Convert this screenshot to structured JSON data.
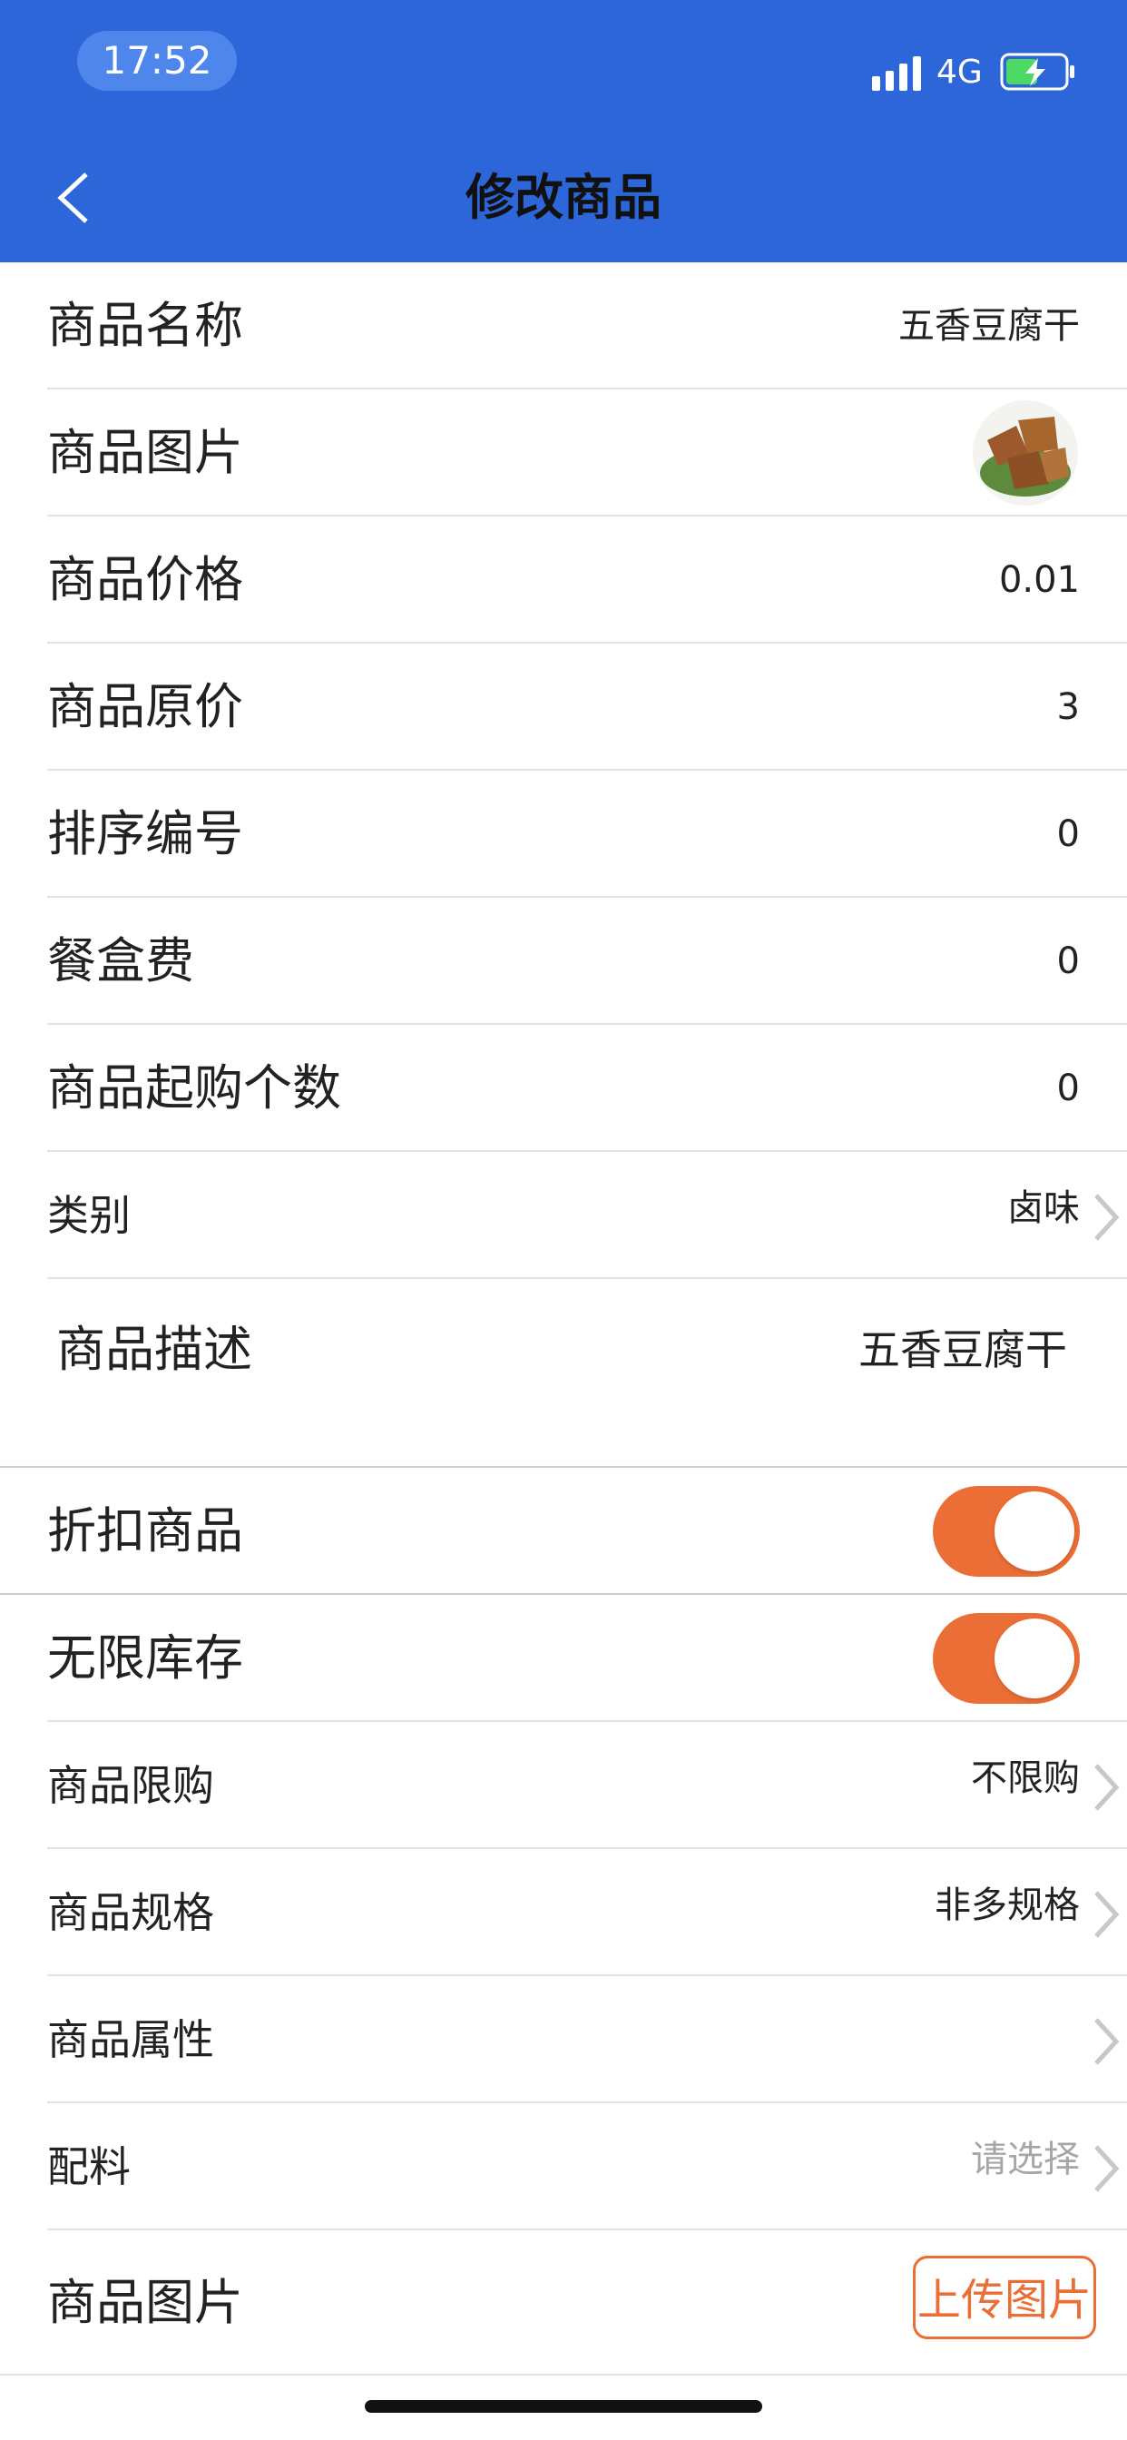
{
  "status_bar": {
    "time": "17:52",
    "network": "4G"
  },
  "header": {
    "title": "修改商品"
  },
  "rows": {
    "name": {
      "label": "商品名称",
      "value": "五香豆腐干"
    },
    "image": {
      "label": "商品图片"
    },
    "price": {
      "label": "商品价格",
      "value": "0.01"
    },
    "original_price": {
      "label": "商品原价",
      "value": "3"
    },
    "sort_no": {
      "label": "排序编号",
      "value": "0"
    },
    "box_fee": {
      "label": "餐盒费",
      "value": "0"
    },
    "min_qty": {
      "label": "商品起购个数",
      "value": "0"
    },
    "category": {
      "label": "类别",
      "value": "卤味"
    },
    "description": {
      "label": "商品描述",
      "value": "五香豆腐干"
    },
    "discount": {
      "label": "折扣商品",
      "on": true
    },
    "unlimited_stock": {
      "label": "无限库存",
      "on": true
    },
    "purchase_limit": {
      "label": "商品限购",
      "value": "不限购"
    },
    "spec": {
      "label": "商品规格",
      "value": "非多规格"
    },
    "attributes": {
      "label": "商品属性",
      "value": ""
    },
    "ingredients": {
      "label": "配料",
      "placeholder": "请选择"
    },
    "images_upload": {
      "label": "商品图片",
      "button": "上传图片"
    }
  },
  "colors": {
    "header": "#2c66d8",
    "accent": "#ea6e35",
    "divider": "#e3e3e3"
  }
}
